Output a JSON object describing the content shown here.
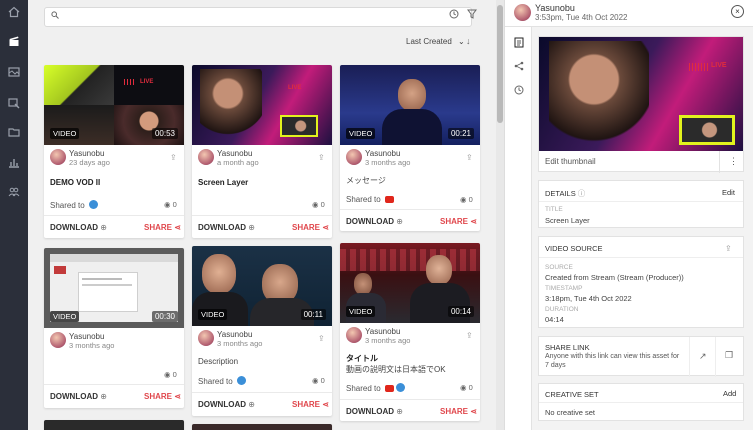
{
  "nav": {
    "icons": [
      "home-icon",
      "clapperboard-icon",
      "media-icon",
      "broadcast-icon",
      "folder-icon",
      "analytics-icon",
      "team-icon"
    ]
  },
  "toolbar": {
    "search_placeholder": "",
    "sort_label": "Last Created"
  },
  "cards": [
    {
      "author": "Yasunobu",
      "age": "23 days ago",
      "tag": "VIDEO",
      "duration": "00:53",
      "title": "DEMO VOD II",
      "description": "",
      "shared_label": "Shared to",
      "shared_platforms": [
        "twitter"
      ],
      "views": "0",
      "download": "DOWNLOAD",
      "share": "SHARE"
    },
    {
      "author": "Yasunobu",
      "age": "a month ago",
      "tag": "",
      "duration": "",
      "title": "Screen Layer",
      "description": "",
      "shared_label": "",
      "shared_platforms": [],
      "views": "0",
      "download": "DOWNLOAD",
      "share": "SHARE"
    },
    {
      "author": "Yasunobu",
      "age": "3 months ago",
      "tag": "VIDEO",
      "duration": "00:21",
      "title": "メッセージ",
      "description": "",
      "shared_label": "Shared to",
      "shared_platforms": [
        "youtube"
      ],
      "views": "0",
      "download": "DOWNLOAD",
      "share": "SHARE"
    },
    {
      "author": "Yasunobu",
      "age": "3 months ago",
      "tag": "VIDEO",
      "duration": "00:30",
      "title": "",
      "description": "",
      "shared_label": "",
      "shared_platforms": [],
      "views": "0",
      "download": "DOWNLOAD",
      "share": "SHARE"
    },
    {
      "author": "Yasunobu",
      "age": "3 months ago",
      "tag": "VIDEO",
      "duration": "00:11",
      "title": "",
      "description": "Description",
      "shared_label": "Shared to",
      "shared_platforms": [
        "twitter"
      ],
      "views": "0",
      "download": "DOWNLOAD",
      "share": "SHARE"
    },
    {
      "author": "Yasunobu",
      "age": "3 months ago",
      "tag": "VIDEO",
      "duration": "00:14",
      "title": "タイトル",
      "description": "動画の説明文は日本語でOK",
      "shared_label": "Shared to",
      "shared_platforms": [
        "youtube",
        "twitter"
      ],
      "views": "0",
      "download": "DOWNLOAD",
      "share": "SHARE"
    }
  ],
  "panel": {
    "author": "Yasunobu",
    "timestamp": "3:53pm, Tue 4th Oct 2022",
    "thumbnail_live": "LIVE",
    "edit_thumbnail": "Edit thumbnail",
    "details": {
      "heading": "DETAILS",
      "edit": "Edit",
      "title_label": "TITLE",
      "title_value": "Screen Layer"
    },
    "video_source": {
      "heading": "VIDEO SOURCE",
      "source_label": "SOURCE",
      "source_value": "Created from Stream (Stream (Producer))",
      "timestamp_label": "TIMESTAMP",
      "timestamp_value": "3:18pm, Tue 4th Oct 2022",
      "duration_label": "DURATION",
      "duration_value": "04:14"
    },
    "share_link": {
      "heading": "SHARE LINK",
      "text": "Anyone with this link can view this asset for 7 days"
    },
    "creative_set": {
      "heading": "CREATIVE SET",
      "add": "Add",
      "value": "No creative set"
    }
  },
  "thumbnail_live_labels": [
    "LIVE"
  ],
  "colors": {
    "rail": "#2b2f3a",
    "accent": "#e0474c",
    "twitter": "#3b8fd8",
    "youtube": "#e0261b"
  }
}
